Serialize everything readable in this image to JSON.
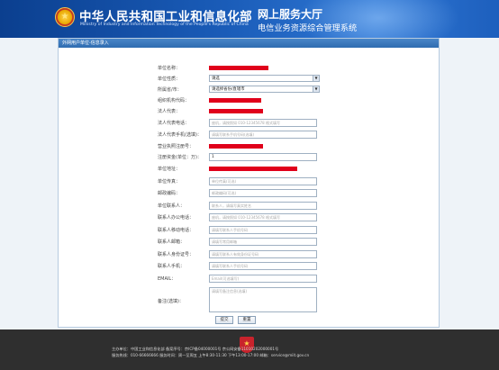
{
  "header": {
    "ministry_name": "中华人民共和国工业和信息化部",
    "ministry_name_en": "Ministry of Industry and Information Technology of the People's Republic of China",
    "hall_title": "网上服务大厅",
    "hall_subtitle": "电信业务资源综合管理系统",
    "emblem_icon": "national-emblem-icon"
  },
  "form": {
    "title": "外网用户单位-信息录入",
    "fields": [
      {
        "label": "单位名称：",
        "value": "",
        "redacted": true
      },
      {
        "label": "单位性质：",
        "value": "请选",
        "type": "select"
      },
      {
        "label": "所属省/市：",
        "value": "请选择省份/直辖市",
        "type": "select"
      },
      {
        "label": "组织机构代码：",
        "value": "",
        "redacted": true
      },
      {
        "label": "法人代表：",
        "value": "",
        "redacted": true
      },
      {
        "label": "法人代表电话：",
        "placeholder": "座机，请按照如 010-12345678 格式填写"
      },
      {
        "label": "法人代表手机(选填)：",
        "placeholder": "请填写联系手机号码(选填)"
      },
      {
        "label": "营业执照注册号：",
        "value": "",
        "redacted": true
      },
      {
        "label": "注册资金(单位：万)：",
        "value": "1"
      },
      {
        "label": "单位地址：",
        "value": "",
        "redacted": true
      },
      {
        "label": "单位传真：",
        "placeholder": "单位传真(可选)"
      },
      {
        "label": "邮政编码：",
        "placeholder": "邮政编码(可选)"
      },
      {
        "label": "单位联系人：",
        "placeholder": "联系人，请填写真实姓名"
      },
      {
        "label": "联系人办公电话：",
        "placeholder": "座机，请按照如 010-12345678 格式填写"
      },
      {
        "label": "联系人移动电话：",
        "placeholder": "请填写联系人手机号码"
      },
      {
        "label": "联系人邮箱：",
        "placeholder": "请填写常用邮箱"
      },
      {
        "label": "联系人身份证号：",
        "placeholder": "请填写联系人有效身份证号码"
      },
      {
        "label": "联系人手机：",
        "placeholder": "请填写联系人手机号码"
      },
      {
        "label": "EMAIL：",
        "placeholder": "Email(可选填写)"
      },
      {
        "label": "备注(选填)：",
        "placeholder": "请填写备注信息(选填)",
        "type": "textarea"
      }
    ],
    "submit_label": "提交",
    "reset_label": "重置"
  },
  "footer": {
    "line1": "主办单位：中国工业和信息化部  备案序号：京ICP备04000001号  京公网安备11010202000001号",
    "line2": "服务热线：010-66666666  服务时间：周一至周五 上午8:30-11:30 下午13:00-17:00  邮箱：service@miit.gov.cn",
    "badge_icon": "police-badge-icon",
    "badge_glyph": "★"
  },
  "colors": {
    "header_blue": "#1a5cb8",
    "card_title_blue": "#2f6cb0",
    "redaction_red": "#e0001b",
    "footer_dark": "#2f2f2f"
  }
}
